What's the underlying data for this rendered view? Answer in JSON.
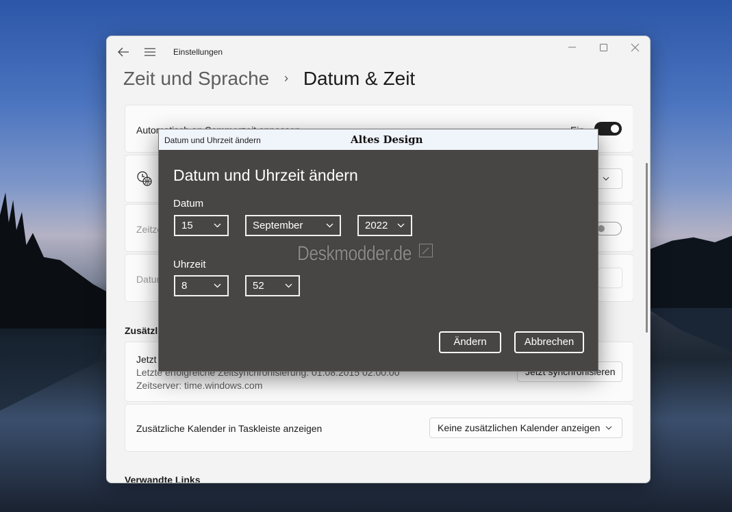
{
  "window": {
    "app_title": "Einstellungen",
    "breadcrumb_parent": "Zeit und Sprache",
    "breadcrumb_separator": "›",
    "breadcrumb_current": "Datum & Zeit"
  },
  "settings": {
    "dst_label": "Automatisch an Sommerzeit anpassen",
    "dst_state": "Ein",
    "timezone_prefix": "Zeitzo",
    "date_prefix": "Datum",
    "additional_section_prefix": "Zusätzlic",
    "sync_title_prefix": "Jetzt s",
    "last_sync": "Letzte erfolgreiche Zeitsynchronisierung: 01.08.2015 02:00:00",
    "time_server": "Zeitserver: time.windows.com",
    "sync_button": "Jetzt synchronisieren",
    "calendar_label": "Zusätzliche Kalender in Taskleiste anzeigen",
    "calendar_value": "Keine zusätzlichen Kalender anzeigen",
    "related_links": "Verwandte Links"
  },
  "dialog": {
    "window_title": "Datum und Uhrzeit ändern",
    "badge": "Altes Design",
    "heading": "Datum und Uhrzeit ändern",
    "date_label": "Datum",
    "day": "15",
    "month": "September",
    "year": "2022",
    "time_label": "Uhrzeit",
    "hour": "8",
    "minute": "52",
    "change_button": "Ändern",
    "cancel_button": "Abbrechen"
  },
  "watermark": "Deskmodder.de",
  "colors": {
    "dialog_bg": "#484644",
    "dialog_titlebar": "#f0f4fb",
    "window_bg": "#f3f3f3",
    "toggle_on": "#202020"
  }
}
